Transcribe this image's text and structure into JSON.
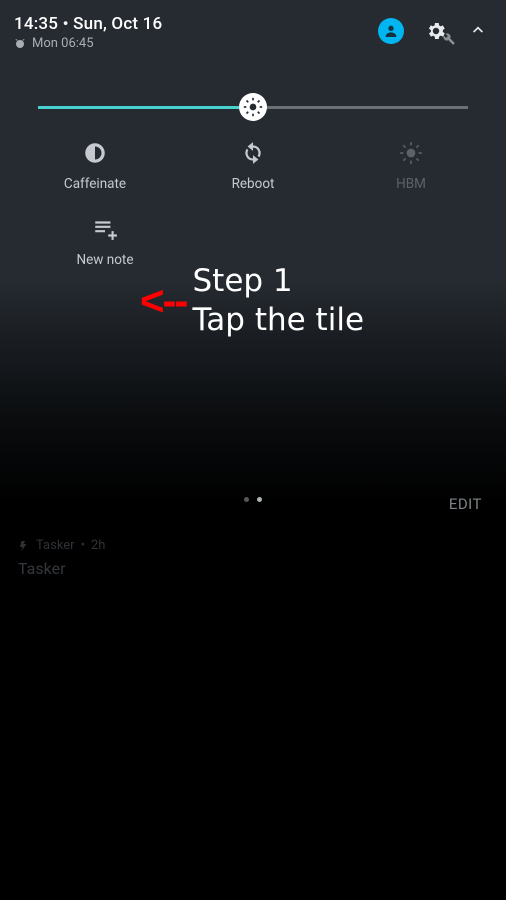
{
  "status": {
    "time": "14:35",
    "separator": "•",
    "date": "Sun, Oct 16",
    "alarm": "Mon 06:45"
  },
  "tiles": {
    "row1": [
      {
        "label": "Caffeinate"
      },
      {
        "label": "Reboot"
      },
      {
        "label": "HBM"
      }
    ],
    "row2": [
      {
        "label": "New note"
      }
    ]
  },
  "annotation": {
    "arrow": "<--",
    "line1": "Step 1",
    "line2": "Tap the tile"
  },
  "edit_label": "EDIT",
  "notification": {
    "app": "Tasker",
    "age": "2h",
    "title": "Tasker"
  }
}
